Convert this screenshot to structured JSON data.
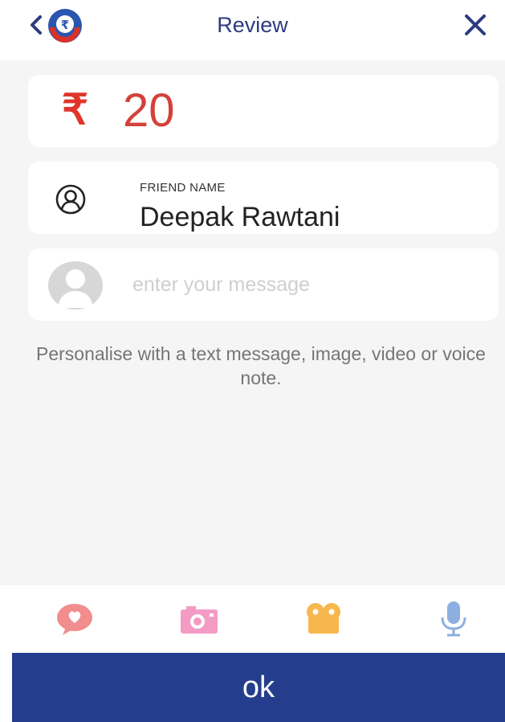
{
  "header": {
    "title": "Review",
    "back_icon": "chevron-left-icon",
    "logo_icon": "rupee-logo-icon",
    "close_icon": "close-icon"
  },
  "amount": {
    "currency_symbol": "₹",
    "value": "20"
  },
  "friend": {
    "label": "FRIEND NAME",
    "name": "Deepak Rawtani",
    "icon": "person-outline-icon"
  },
  "message": {
    "placeholder": "enter your message",
    "value": "",
    "avatar_icon": "user-avatar-icon"
  },
  "hint": "Personalise with a text message, image, video or voice note.",
  "toolbar": {
    "items": [
      {
        "name": "text-message",
        "icon": "chat-heart-icon"
      },
      {
        "name": "image",
        "icon": "camera-icon"
      },
      {
        "name": "video",
        "icon": "video-camera-icon"
      },
      {
        "name": "voice-note",
        "icon": "microphone-icon"
      }
    ]
  },
  "ok_label": "ok",
  "colors": {
    "accent": "#243d8c",
    "title": "#2d3a80",
    "amount": "#d4413a",
    "background": "#f5f5f5"
  }
}
